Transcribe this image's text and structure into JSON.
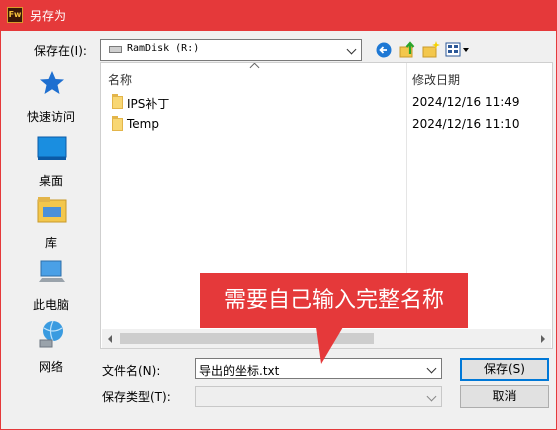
{
  "window": {
    "app_icon_text": "Fw",
    "title": "另存为"
  },
  "toolbar": {
    "save_in_label": "保存在(I):",
    "location_value": "RamDisk (R:)",
    "back_icon": "back-arrow-icon",
    "up_icon": "up-folder-icon",
    "new_folder_icon": "new-folder-icon",
    "view_menu_icon": "view-menu-icon"
  },
  "places": [
    {
      "label": "快速访问",
      "icon": "star-icon"
    },
    {
      "label": "桌面",
      "icon": "desktop-icon"
    },
    {
      "label": "库",
      "icon": "library-icon"
    },
    {
      "label": "此电脑",
      "icon": "computer-icon"
    },
    {
      "label": "网络",
      "icon": "network-icon"
    }
  ],
  "file_list": {
    "col_name": "名称",
    "col_date": "修改日期",
    "rows": [
      {
        "name": "IPS补丁",
        "date": "2024/12/16 11:49"
      },
      {
        "name": "Temp",
        "date": "2024/12/16 11:10"
      }
    ]
  },
  "form": {
    "filename_label": "文件名(N):",
    "filename_value": "导出的坐标.txt",
    "filetype_label": "保存类型(T):",
    "filetype_value": ""
  },
  "buttons": {
    "save": "保存(S)",
    "cancel": "取消"
  },
  "annotation": {
    "text": "需要自己输入完整名称"
  },
  "colors": {
    "titlebar": "#e5393a",
    "annotation": "#e5393a",
    "default_button_border": "#0078d7"
  }
}
